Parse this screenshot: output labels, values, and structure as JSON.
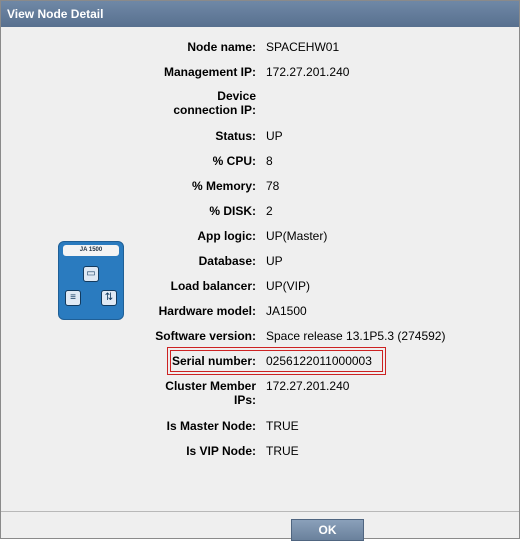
{
  "dialog": {
    "title": "View Node Detail",
    "device_label": "JA 1500",
    "ok_label": "OK"
  },
  "fields": [
    {
      "label": "Node name:",
      "value": "SPACEHW01"
    },
    {
      "label": "Management IP:",
      "value": "172.27.201.240"
    },
    {
      "label_line1": "Device",
      "label_line2": "connection IP:",
      "value": ""
    },
    {
      "label": "Status:",
      "value": "UP"
    },
    {
      "label": "% CPU:",
      "value": "8"
    },
    {
      "label": "% Memory:",
      "value": "78"
    },
    {
      "label": "% DISK:",
      "value": "2"
    },
    {
      "label": "App logic:",
      "value": "UP(Master)"
    },
    {
      "label": "Database:",
      "value": "UP"
    },
    {
      "label": "Load balancer:",
      "value": "UP(VIP)"
    },
    {
      "label": "Hardware model:",
      "value": "JA1500"
    },
    {
      "label": "Software version:",
      "value": "Space release 13.1P5.3 (274592)"
    },
    {
      "label": "Serial number:",
      "value": "0256122011000003"
    },
    {
      "label_line1": "Cluster Member",
      "label_line2": "IPs:",
      "value": "172.27.201.240"
    },
    {
      "label": "Is Master Node:",
      "value": "TRUE"
    },
    {
      "label": "Is VIP Node:",
      "value": "TRUE"
    }
  ],
  "colors": {
    "titlebar": "#5f7898",
    "highlight_border": "#cc2222",
    "device_body": "#2a7bbf"
  }
}
